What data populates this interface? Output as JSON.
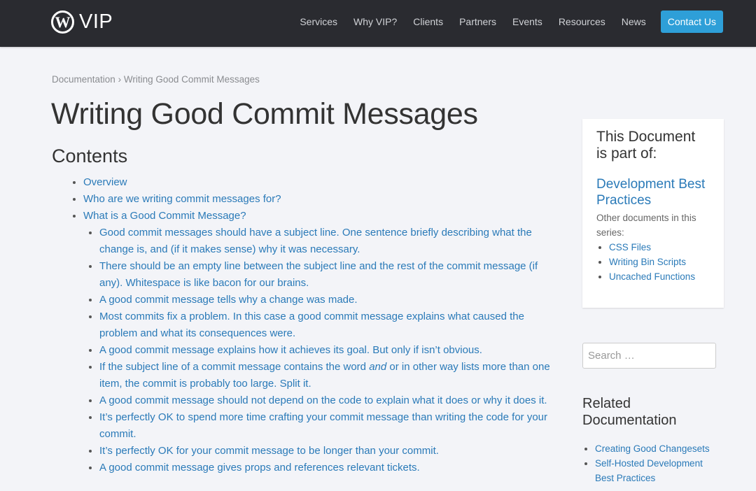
{
  "header": {
    "logo_text": "VIP",
    "nav": [
      "Services",
      "Why VIP?",
      "Clients",
      "Partners",
      "Events",
      "Resources",
      "News"
    ],
    "contact": "Contact Us"
  },
  "breadcrumb": {
    "parent": "Documentation",
    "sep": "›",
    "current": "Writing Good Commit Messages"
  },
  "title": "Writing Good Commit Messages",
  "contents_heading": "Contents",
  "toc": {
    "top": [
      "Overview",
      "Who are we writing commit messages for?",
      "What is a Good Commit Message?"
    ],
    "sub": [
      "Good commit messages should have a subject line. One sentence briefly describing what the change is, and (if it makes sense) why it was necessary.",
      "There should be an empty line between the subject line and the rest of the commit message (if any). Whitespace is like bacon for our brains.",
      "A good commit message tells why a change was made.",
      "Most commits fix a problem. In this case a good commit message explains what caused the problem and what its consequences were.",
      "A good commit message explains how it achieves its goal. But only if isn’t obvious.",
      {
        "before": "If the subject line of a commit message contains the word ",
        "em": "and",
        "after": " or in other way lists more than one item, the commit is probably too large. Split it."
      },
      "A good commit message should not depend on the code to explain what it does or why it does it.",
      "It’s perfectly OK to spend more time crafting your commit message than writing the code for your commit.",
      "It’s perfectly OK for your commit message to be longer than your commit.",
      "A good commit message gives props and references relevant tickets."
    ]
  },
  "sidebar": {
    "heading": "This Document is part of:",
    "series": "Development Best Practices",
    "other_label": "Other documents in this series:",
    "others": [
      "CSS Files",
      "Writing Bin Scripts",
      "Uncached Functions"
    ]
  },
  "search": {
    "placeholder": "Search …"
  },
  "related": {
    "heading": "Related Documentation",
    "items": [
      "Creating Good Changesets",
      "Self-Hosted Development Best Practices"
    ]
  }
}
